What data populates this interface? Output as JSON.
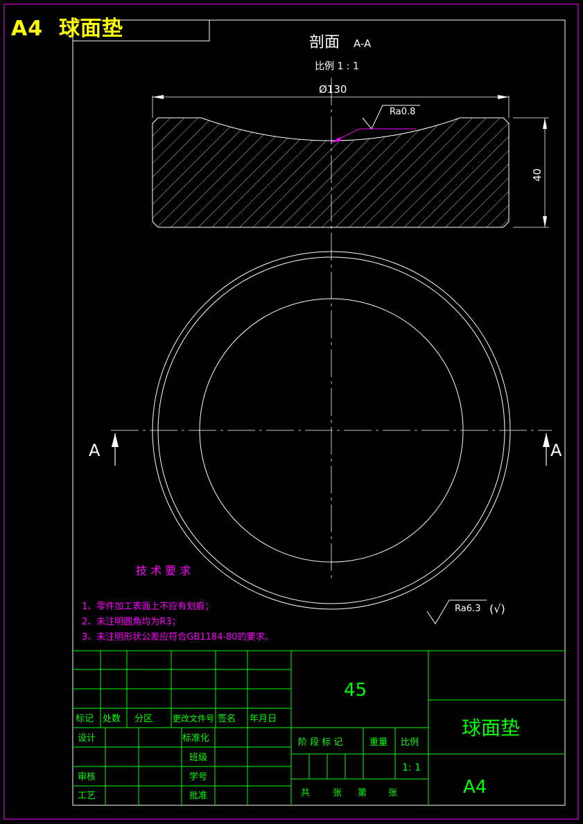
{
  "header": {
    "sheet_tag": "A4",
    "part_name": "球面垫"
  },
  "section_view": {
    "title": "剖面",
    "label": "A-A",
    "scale_text": "比例  1 : 1",
    "diameter_dim": "Ø130",
    "height_dim": "40",
    "roughness_top": "Ra0.8"
  },
  "plan_view": {
    "cut_label_left": "A",
    "cut_label_right": "A"
  },
  "surface_finish": {
    "label": "Ra6.3",
    "paren": "(√)"
  },
  "tech_requirements": {
    "title": "技 术 要 求",
    "items": [
      "1、零件加工表面上不应有划痕；",
      "2、未注明圆角均为R3；",
      "3、未注明形状公差应符合GB1184-80的要求。"
    ]
  },
  "title_block": {
    "material": "45",
    "part_name": "球面垫",
    "sheet_size": "A4",
    "headers": [
      "标记",
      "处数",
      "分区",
      "更改文件号",
      "签名",
      "年月日"
    ],
    "row_design": "设计",
    "row_standard": "标准化",
    "row_class": "班级",
    "row_review": "审核",
    "row_student_no": "学号",
    "row_process": "工艺",
    "row_approve": "批准",
    "stage_mark": "阶 段 标 记",
    "weight": "重量",
    "scale_label": "比例",
    "scale_value": "1: 1",
    "sheets_total": "共",
    "sheets_unit1": "张",
    "sheets_no": "第",
    "sheets_unit2": "张"
  },
  "colors": {
    "line": "#ffffff",
    "border": "#ff00ff",
    "title_block": "#00ff00",
    "text_magenta": "#ff00ff",
    "tag": "#ffff00"
  }
}
